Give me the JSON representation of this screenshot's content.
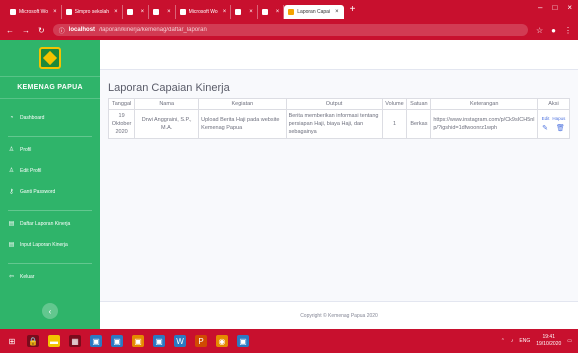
{
  "browser": {
    "tabs": [
      {
        "label": "Microsoft Wo",
        "active": false
      },
      {
        "label": "Simpro sekolah",
        "active": false
      },
      {
        "label": "",
        "active": false
      },
      {
        "label": "",
        "active": false
      },
      {
        "label": "Microsoft Wo",
        "active": false
      },
      {
        "label": "",
        "active": false
      },
      {
        "label": "",
        "active": false
      },
      {
        "label": "Laporan Capai",
        "active": true
      }
    ],
    "url_host": "localhost",
    "url_path": "/laporan/kinerja/kemenag/daftar_laporan"
  },
  "sidebar": {
    "brand": "KEMENAG PAPUA",
    "items": [
      {
        "icon": "dashboard-icon",
        "label": "Dashboard"
      },
      {
        "icon": "profile-icon",
        "label": "Profil"
      },
      {
        "icon": "edit-profile-icon",
        "label": "Edit Profil"
      },
      {
        "icon": "key-icon",
        "label": "Ganti Password"
      },
      {
        "icon": "list-icon",
        "label": "Daftar Laporan Kinerja"
      },
      {
        "icon": "input-icon",
        "label": "Input Laporan Kinerja"
      },
      {
        "icon": "logout-icon",
        "label": "Keluar"
      }
    ]
  },
  "main": {
    "title": "Laporan Capaian Kinerja",
    "columns": [
      "Tanggal",
      "Nama",
      "Kegiatan",
      "Output",
      "Volume",
      "Satuan",
      "Keterangan",
      "Aksi"
    ],
    "rows": [
      {
        "tanggal": "19 Oktober 2020",
        "nama": "Drwi Anggraini, S.P., M.A.",
        "kegiatan": "Upload Berita Haji pada website Kemenag Papua",
        "output": "Berita memberikan informasi tentang persiapan Haji, biaya Haji, dan sebagainya",
        "volume": "1",
        "satuan": "Berkas",
        "keterangan": "https://www.instagram.com/p/Ck9sICH5nlp/?igshid=1dfwoonrz1wph",
        "aksi_edit": "Edit",
        "aksi_hapus": "Hapus"
      }
    ],
    "footer": "Copyright © Kemenag Papua 2020"
  },
  "taskbar": {
    "time": "19:41",
    "date": "19/10/2020",
    "lang": "ENG"
  },
  "colors": {
    "browser_red": "#c8102e",
    "sidebar_green": "#2fb46a",
    "accent_blue": "#4e73df"
  }
}
